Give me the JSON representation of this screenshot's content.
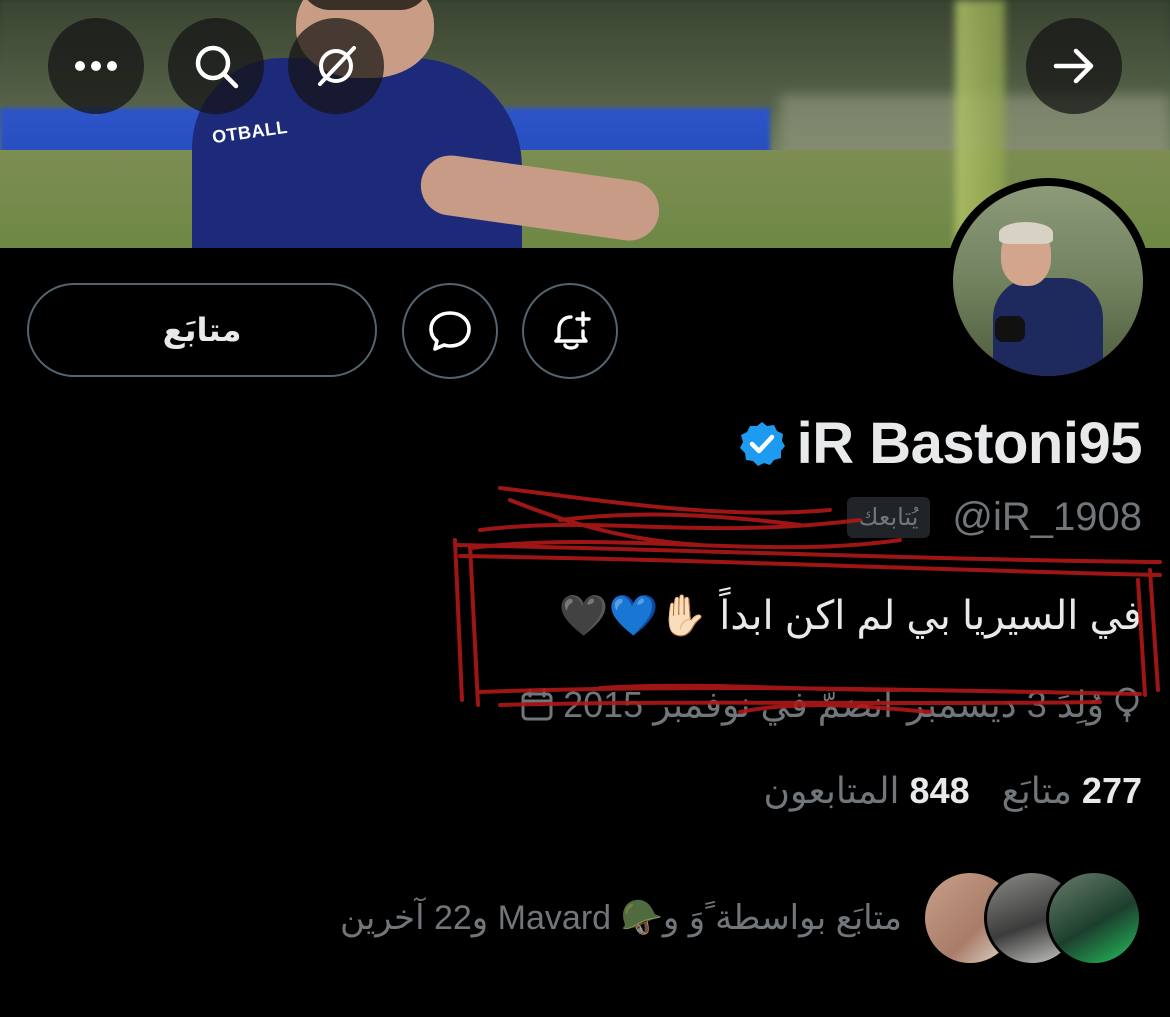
{
  "banner": {
    "shirt_text": "OTBALL",
    "buttons": {
      "more_icon": "more-icon",
      "search_icon": "search-icon",
      "grok_icon": "grok-icon",
      "back_icon": "arrow-right-icon"
    }
  },
  "actions": {
    "follow_label": "متابَع",
    "message_icon": "message-icon",
    "notifications_icon": "bell-plus-icon"
  },
  "profile": {
    "display_name": "iR Bastoni95",
    "verified": true,
    "handle": "@iR_1908",
    "follows_you": "يُتابعك",
    "bio": "في السيريا بي لم اكن ابداً ✋🏻💙🖤",
    "born": "وُلِدَ 3 ديسمبر",
    "joined": "انضمّ في نوفمبر 2015"
  },
  "stats": {
    "following_count": "277",
    "following_label": "متابَع",
    "followers_count": "848",
    "followers_label": "المتابعون"
  },
  "followed_by": {
    "text": "متابَع بواسطة ًوَ و🪖 Mavard و22 آخرين"
  },
  "colors": {
    "background": "#000000",
    "text_primary": "#e7e9ea",
    "text_secondary": "#71767b",
    "border": "#536471",
    "verified": "#1d9bf0",
    "annotation_red": "#b01818"
  }
}
